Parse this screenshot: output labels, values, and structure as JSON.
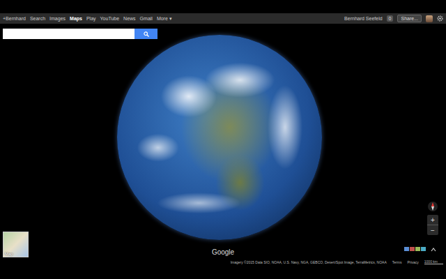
{
  "topbar": {
    "links": [
      {
        "label": "+Bernhard",
        "selected": false
      },
      {
        "label": "Search",
        "selected": false
      },
      {
        "label": "Images",
        "selected": false
      },
      {
        "label": "Maps",
        "selected": true
      },
      {
        "label": "Play",
        "selected": false
      },
      {
        "label": "YouTube",
        "selected": false
      },
      {
        "label": "News",
        "selected": false
      },
      {
        "label": "Gmail",
        "selected": false
      },
      {
        "label": "More ▾",
        "selected": false
      }
    ],
    "user": "Bernhard Seefeld",
    "notifications": "0",
    "share": "Share..."
  },
  "map_type": {
    "label": "Map"
  },
  "zoom": {
    "in": "+",
    "out": "−"
  },
  "logo": "Google",
  "footer": {
    "attribution": "Imagery ©2015 Data SIO, NOAA, U.S. Navy, NGA, GEBCO, Desert/Spot Image, TerraMetrics, NOAA",
    "links": [
      "Terms",
      "Privacy"
    ],
    "scale": "1000 km"
  }
}
